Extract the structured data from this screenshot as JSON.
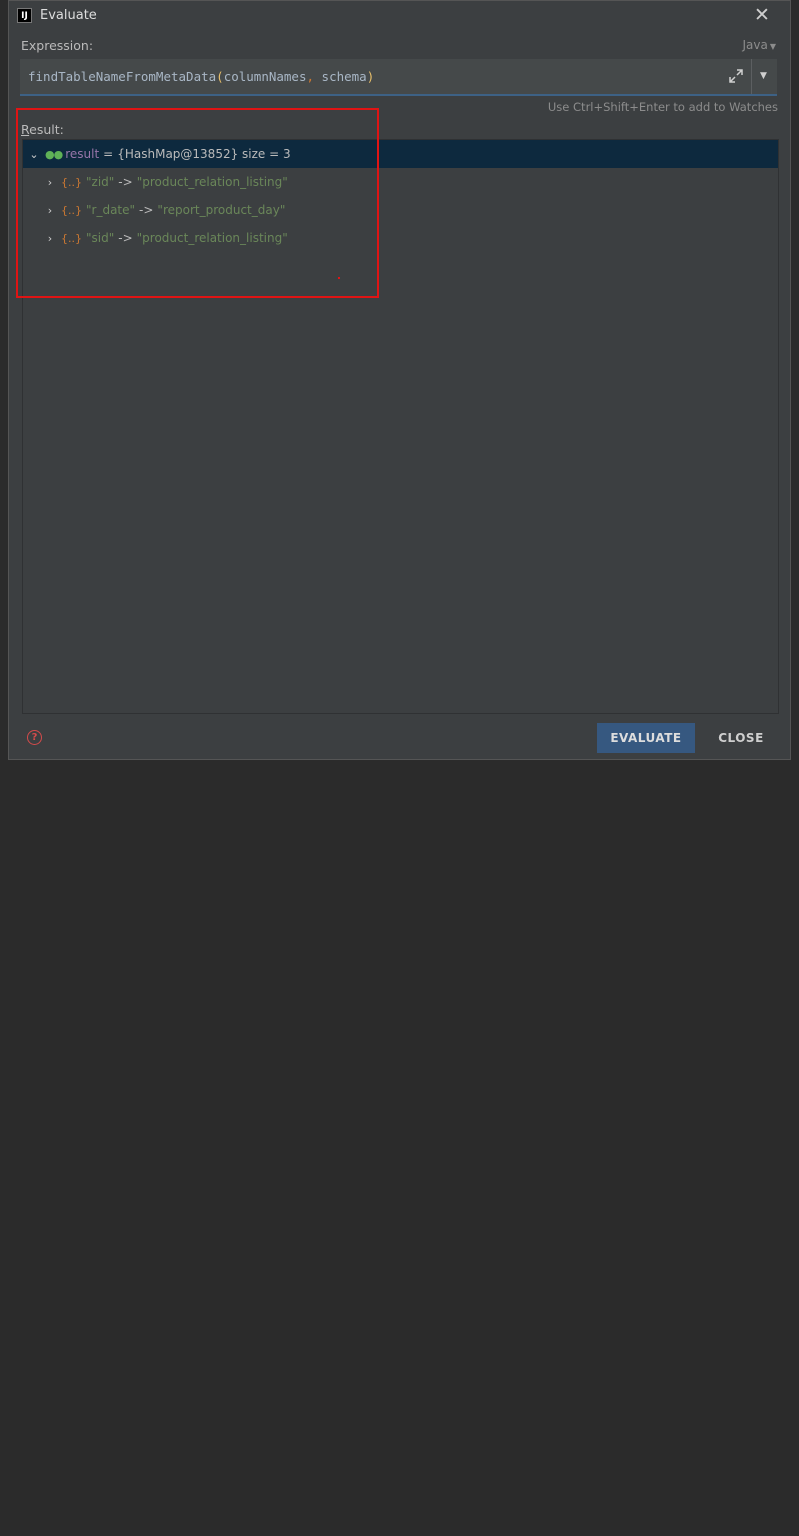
{
  "window": {
    "title": "Evaluate",
    "app_icon_label": "IJ"
  },
  "expression": {
    "label": "Expression:",
    "language": "Java",
    "value_parts": {
      "func": "findTableNameFromMetaData",
      "open_paren": "(",
      "arg1": "columnNames",
      "comma": ",",
      "arg2": " schema",
      "close_paren": ")"
    },
    "hint": "Use Ctrl+Shift+Enter to add to Watches"
  },
  "result": {
    "label_first": "R",
    "label_rest": "esult:",
    "root": {
      "name": "result",
      "eq": "=",
      "value": "{HashMap@13852}  size = 3"
    },
    "entries": [
      {
        "key": "\"zid\"",
        "arrow": "->",
        "value": "\"product_relation_listing\""
      },
      {
        "key": "\"r_date\"",
        "arrow": "->",
        "value": "\"report_product_day\""
      },
      {
        "key": "\"sid\"",
        "arrow": "->",
        "value": "\"product_relation_listing\""
      }
    ]
  },
  "buttons": {
    "evaluate": "EVALUATE",
    "close": "CLOSE"
  },
  "icons": {
    "close": "close-icon",
    "expand": "expand-icon",
    "dropdown": "chevron-down-icon",
    "help": "help-icon"
  },
  "colors": {
    "annotation": "#e01414",
    "accent": "#365880"
  }
}
